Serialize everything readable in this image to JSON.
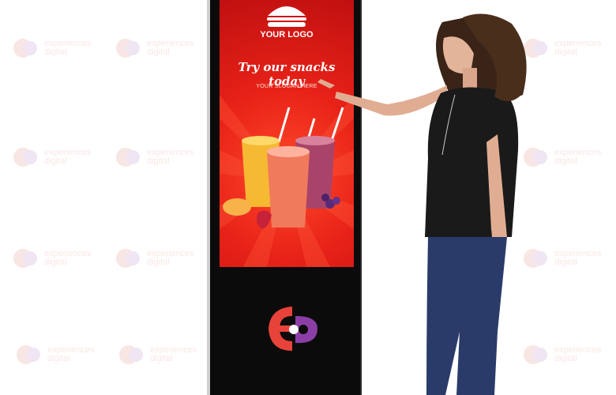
{
  "scene": {
    "background_color": "#ffffff",
    "watermark": {
      "line1": "experiences",
      "line2": "digital",
      "color": "#d04a3a"
    }
  },
  "kiosk": {
    "frame_color": "#0b0b0b",
    "screen": {
      "logo_label": "YOUR LOGO",
      "headline": "Try our snacks today",
      "slogan": "YOUR SLOGAN HERE",
      "accent_color": "#e82218",
      "icons": [
        "burger-icon",
        "smoothie-cups",
        "fruit"
      ]
    },
    "bottom_logo": {
      "icon": "experiences-digital-logo",
      "colors": [
        "#e8433a",
        "#8b3fa6"
      ]
    }
  },
  "person": {
    "shirt_color": "#1a1a1a",
    "jeans_color": "#2a3b6a",
    "hair_color": "#3a2418"
  }
}
